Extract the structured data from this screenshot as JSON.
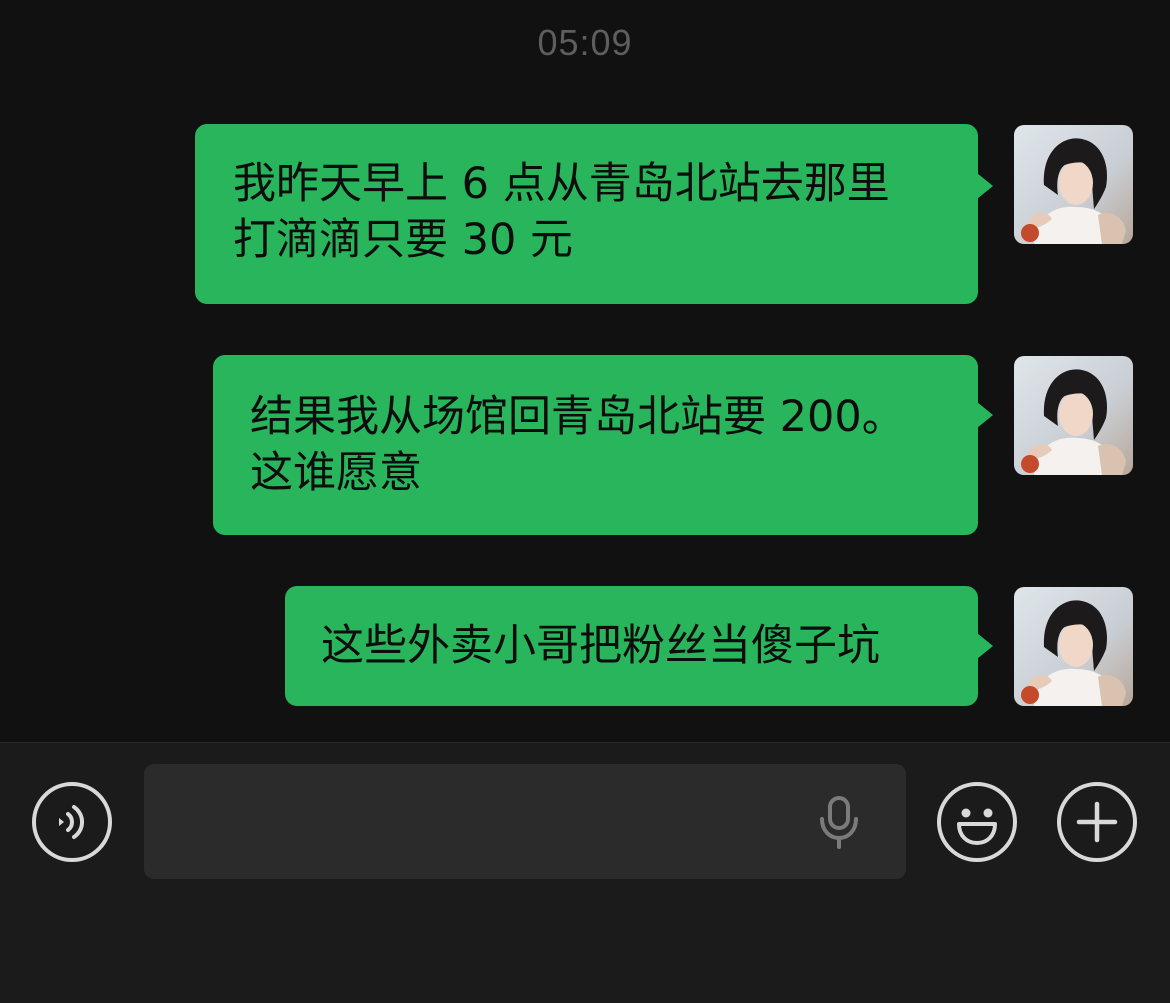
{
  "header": {
    "timestamp": "05:09"
  },
  "messages": [
    {
      "sender": "self",
      "text": "我昨天早上 6 点从青岛北站去那里\n打滴滴只要 30 元"
    },
    {
      "sender": "self",
      "text": "结果我从场馆回青岛北站要 200。\n这谁愿意"
    },
    {
      "sender": "self",
      "text": "这些外卖小哥把粉丝当傻子坑"
    }
  ],
  "input_bar": {
    "text_value": "",
    "placeholder": "",
    "voice_icon": "voice-icon",
    "mic_icon": "microphone-icon",
    "emoji_icon": "emoji-smiley-icon",
    "plus_icon": "plus-icon"
  },
  "colors": {
    "background": "#111111",
    "bubble": "#28b55c",
    "input_bar": "#1b1b1b",
    "input_field": "#2b2b2b",
    "icon": "#d9d9d9"
  }
}
